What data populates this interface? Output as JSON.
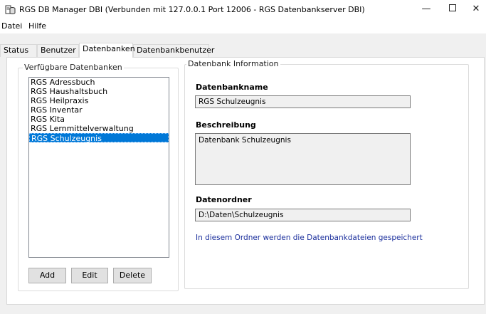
{
  "window": {
    "title": "RGS DB Manager DBI (Verbunden mit 127.0.0.1 Port 12006 - RGS Datenbankserver DBI)",
    "minimize": "—",
    "close": "✕"
  },
  "menu": {
    "items": [
      "Datei",
      "Hilfe"
    ]
  },
  "tabs": [
    "Status",
    "Benutzer",
    "Datenbanken",
    "Datenbankbenutzer"
  ],
  "active_tab": "Datenbanken",
  "databases": {
    "legend": "Verfügbare Datenbanken",
    "items": [
      "RGS Adressbuch",
      "RGS Haushaltsbuch",
      "RGS Heilpraxis",
      "RGS Inventar",
      "RGS Kita",
      "RGS Lernmittelverwaltung",
      "RGS Schulzeugnis"
    ],
    "selected": "RGS Schulzeugnis",
    "buttons": {
      "add": "Add",
      "edit": "Edit",
      "delete": "Delete"
    }
  },
  "info": {
    "legend": "Datenbank Information",
    "name_label": "Datenbankname",
    "name_value": "RGS Schulzeugnis",
    "desc_label": "Beschreibung",
    "desc_value": "Datenbank Schulzeugnis",
    "folder_label": "Datenordner",
    "folder_value": "D:\\Daten\\Schulzeugnis",
    "folder_hint": "In diesem Ordner werden die Datenbankdateien gespeichert"
  },
  "colors": {
    "selection": "#0078d7",
    "hint_text": "#1a2e9c",
    "window_bg": "#f0f0f0"
  }
}
